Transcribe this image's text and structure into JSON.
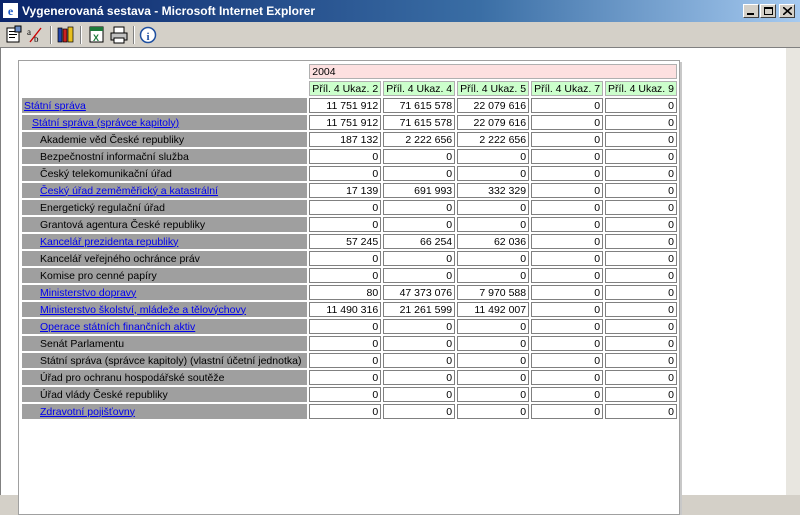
{
  "window": {
    "title": "Vygenerovaná sestava - Microsoft Internet Explorer"
  },
  "toolbar": {
    "icons": [
      "properties-icon",
      "spellcheck-icon",
      "books-icon",
      "excel-icon",
      "print-icon",
      "info-icon"
    ]
  },
  "report": {
    "year": "2004",
    "columns": [
      "Příl. 4 Ukaz. 2",
      "Příl. 4 Ukaz. 4",
      "Příl. 4 Ukaz. 5",
      "Příl. 4 Ukaz. 7",
      "Příl. 4 Ukaz. 9"
    ],
    "rows": [
      {
        "label": "Státní správa",
        "level": 0,
        "link": true,
        "values": [
          "11 751 912",
          "71 615 578",
          "22 079 616",
          "0",
          "0"
        ]
      },
      {
        "label": "Státní správa (správce kapitoly)",
        "level": 1,
        "link": true,
        "values": [
          "11 751 912",
          "71 615 578",
          "22 079 616",
          "0",
          "0"
        ]
      },
      {
        "label": "Akademie věd České republiky",
        "level": 2,
        "link": false,
        "values": [
          "187 132",
          "2 222 656",
          "2 222 656",
          "0",
          "0"
        ]
      },
      {
        "label": "Bezpečnostní informační služba",
        "level": 2,
        "link": false,
        "values": [
          "0",
          "0",
          "0",
          "0",
          "0"
        ]
      },
      {
        "label": "Český telekomunikační úřad",
        "level": 2,
        "link": false,
        "values": [
          "0",
          "0",
          "0",
          "0",
          "0"
        ]
      },
      {
        "label": "Český úřad zeměměřický a katastrální",
        "level": 2,
        "link": true,
        "values": [
          "17 139",
          "691 993",
          "332 329",
          "0",
          "0"
        ]
      },
      {
        "label": "Energetický regulační úřad",
        "level": 2,
        "link": false,
        "values": [
          "0",
          "0",
          "0",
          "0",
          "0"
        ]
      },
      {
        "label": "Grantová agentura České republiky",
        "level": 2,
        "link": false,
        "values": [
          "0",
          "0",
          "0",
          "0",
          "0"
        ]
      },
      {
        "label": "Kancelář prezidenta republiky",
        "level": 2,
        "link": true,
        "values": [
          "57 245",
          "66 254",
          "62 036",
          "0",
          "0"
        ]
      },
      {
        "label": "Kancelář veřejného ochránce práv",
        "level": 2,
        "link": false,
        "values": [
          "0",
          "0",
          "0",
          "0",
          "0"
        ]
      },
      {
        "label": "Komise pro cenné papíry",
        "level": 2,
        "link": false,
        "values": [
          "0",
          "0",
          "0",
          "0",
          "0"
        ]
      },
      {
        "label": "Ministerstvo dopravy",
        "level": 2,
        "link": true,
        "values": [
          "80",
          "47 373 076",
          "7 970 588",
          "0",
          "0"
        ]
      },
      {
        "label": "Ministerstvo školství, mládeže a tělovýchovy",
        "level": 2,
        "link": true,
        "values": [
          "11 490 316",
          "21 261 599",
          "11 492 007",
          "0",
          "0"
        ]
      },
      {
        "label": "Operace státních finančních aktiv",
        "level": 2,
        "link": true,
        "values": [
          "0",
          "0",
          "0",
          "0",
          "0"
        ]
      },
      {
        "label": "Senát Parlamentu",
        "level": 2,
        "link": false,
        "values": [
          "0",
          "0",
          "0",
          "0",
          "0"
        ]
      },
      {
        "label": "Státní správa (správce kapitoly) (vlastní účetní jednotka)",
        "level": 2,
        "link": false,
        "values": [
          "0",
          "0",
          "0",
          "0",
          "0"
        ]
      },
      {
        "label": "Úřad pro ochranu hospodářské soutěže",
        "level": 2,
        "link": false,
        "values": [
          "0",
          "0",
          "0",
          "0",
          "0"
        ]
      },
      {
        "label": "Úřad vlády České republiky",
        "level": 2,
        "link": false,
        "values": [
          "0",
          "0",
          "0",
          "0",
          "0"
        ]
      },
      {
        "label": "Zdravotní pojišťovny",
        "level": 2,
        "link": true,
        "values": [
          "0",
          "0",
          "0",
          "0",
          "0"
        ]
      }
    ]
  }
}
